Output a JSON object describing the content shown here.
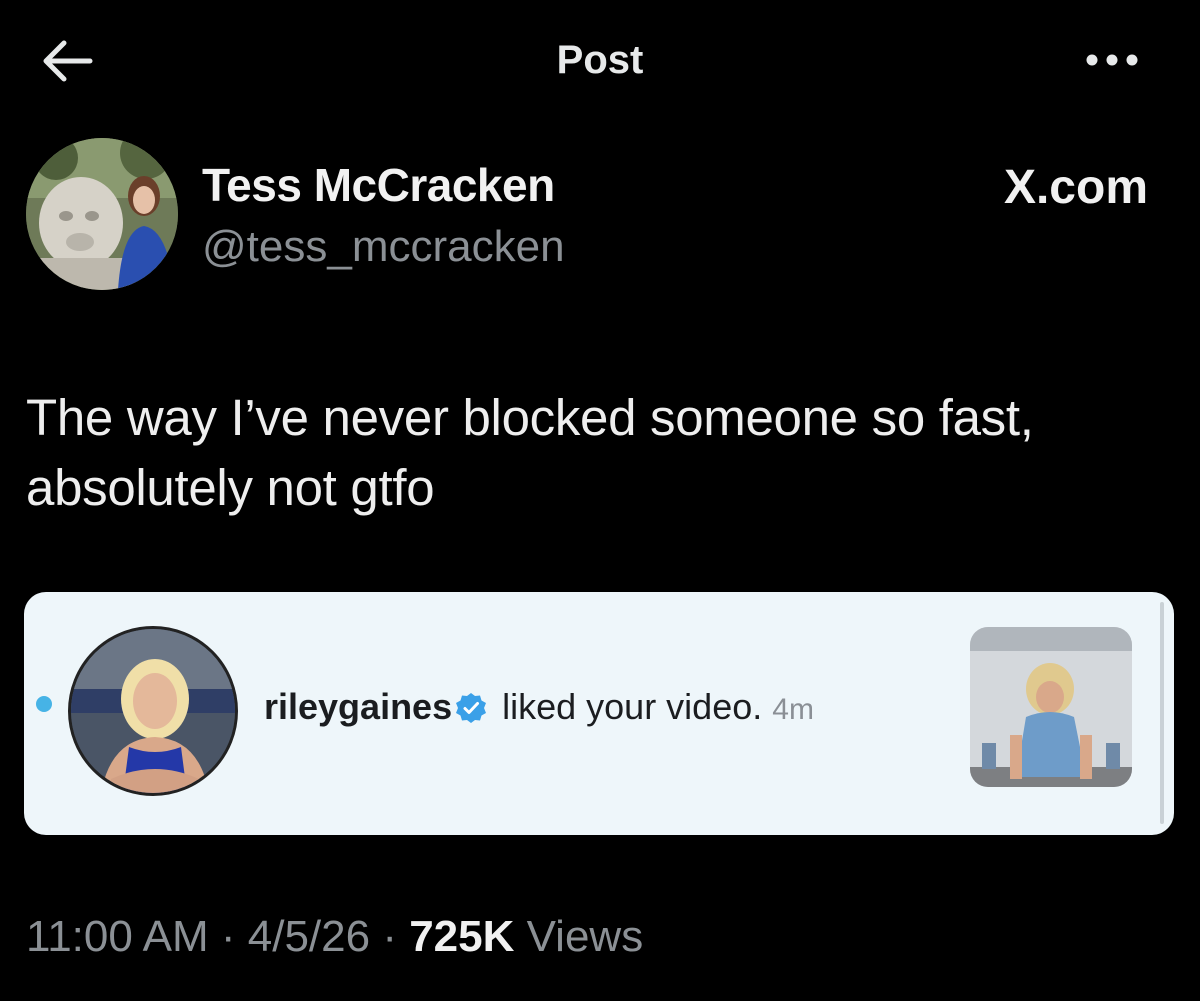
{
  "header": {
    "title": "Post",
    "back_icon": "arrow-left-icon",
    "more_icon": "more-horizontal-icon"
  },
  "author": {
    "display_name": "Tess McCracken",
    "handle": "@tess_mccracken",
    "brand": "X.com"
  },
  "post": {
    "text": "The way I’ve never blocked someone so fast, absolutely not gtfo"
  },
  "embedded_notification": {
    "username": "rileygaines",
    "message": " liked your video.",
    "time": "4m",
    "verified_icon": "verified-badge-icon",
    "unread_color": "#46b3e6"
  },
  "meta": {
    "time": "11:00 AM",
    "sep1": " · ",
    "date": "4/5/26",
    "sep2": " · ",
    "views_count": "725K",
    "views_label": " Views"
  },
  "colors": {
    "background": "#000000",
    "text": "#e7e9ea",
    "muted": "#8b9095",
    "card": "#eef6fa"
  }
}
